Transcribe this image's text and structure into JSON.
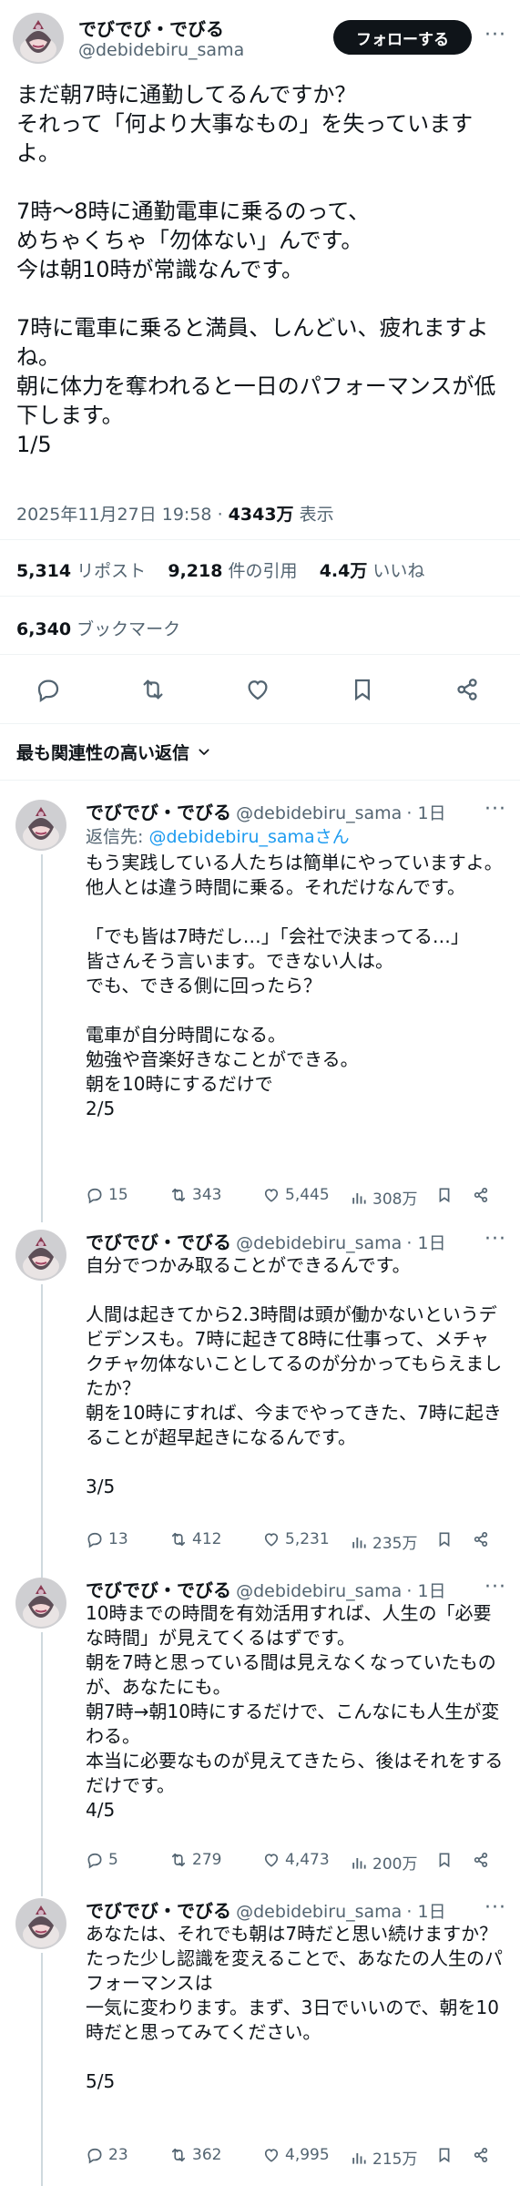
{
  "main": {
    "author": {
      "name": "でびでび・でびる",
      "handle": "@debidebiru_sama"
    },
    "follow_label": "フォローする",
    "more_label": "···",
    "text": "まだ朝7時に通勤してるんですか？\nそれって「何より大事なもの」を失っていますよ。\n\n7時〜8時に通勤電車に乗るのって、\nめちゃくちゃ「勿体ない」んです。\n今は朝10時が常識なんです。\n\n7時に電車に乗ると満員、しんどい、疲れますよね。\n朝に体力を奪われると一日のパフォーマンスが低下します。\n1/5",
    "timestamp": "2025年11月27日 19:58",
    "dot": "·",
    "views_value": "4343万",
    "views_label": "表示",
    "reposts_value": "5,314",
    "reposts_label": "リポスト",
    "quotes_value": "9,218",
    "quotes_label": "件の引用",
    "likes_value": "4.4万",
    "likes_label": "いいね",
    "bookmarks_value": "6,340",
    "bookmarks_label": "ブックマーク"
  },
  "sort": {
    "label": "最も関連性の高い返信"
  },
  "replies": [
    {
      "name": "でびでび・でびる",
      "handle": "@debidebiru_sama",
      "age": "· 1日",
      "reply_to_prefix": "返信先: ",
      "reply_to_user": "@debidebiru_samaさん",
      "text": "もう実践している人たちは簡単にやっていますよ。\n他人とは違う時間に乗る。それだけなんです。\n\n「でも皆は7時だし…」「会社で決まってる…」\n皆さんそう言います。できない人は。\nでも、できる側に回ったら？\n\n電車が自分時間になる。\n勉強や音楽好きなことができる。\n朝を10時にするだけで\n2/5",
      "replies": "15",
      "reposts": "343",
      "likes": "5,445",
      "views": "308万"
    },
    {
      "name": "でびでび・でびる",
      "handle": "@debidebiru_sama",
      "age": "· 1日",
      "text": "自分でつかみ取ることができるんです。\n\n人間は起きてから2.3時間は頭が働かないというデビデンスも。7時に起きて8時に仕事って、メチャクチャ勿体ないことしてるのが分かってもらえましたか？\n朝を10時にすれば、今までやってきた、7時に起きることが超早起きになるんです。\n\n3/5",
      "replies": "13",
      "reposts": "412",
      "likes": "5,231",
      "views": "235万"
    },
    {
      "name": "でびでび・でびる",
      "handle": "@debidebiru_sama",
      "age": "· 1日",
      "text": "10時までの時間を有効活用すれば、人生の「必要な時間」が見えてくるはずです。\n朝を7時と思っている間は見えなくなっていたものが、あなたにも。\n朝7時→朝10時にするだけで、こんなにも人生が変わる。\n本当に必要なものが見えてきたら、後はそれをするだけです。\n4/5",
      "replies": "5",
      "reposts": "279",
      "likes": "4,473",
      "views": "200万"
    },
    {
      "name": "でびでび・でびる",
      "handle": "@debidebiru_sama",
      "age": "· 1日",
      "text": "あなたは、それでも朝は7時だと思い続けますか？\nたった少し認識を変えることで、あなたの人生のパフォーマンスは\n一気に変わります。まず、3日でいいので、朝を10時だと思ってみてください。\n\n5/5",
      "replies": "23",
      "reposts": "362",
      "likes": "4,995",
      "views": "215万"
    }
  ],
  "colors": {
    "text": "#0f1419",
    "secondary": "#536471",
    "link": "#1d9bf0",
    "divider": "#eff3f4"
  }
}
